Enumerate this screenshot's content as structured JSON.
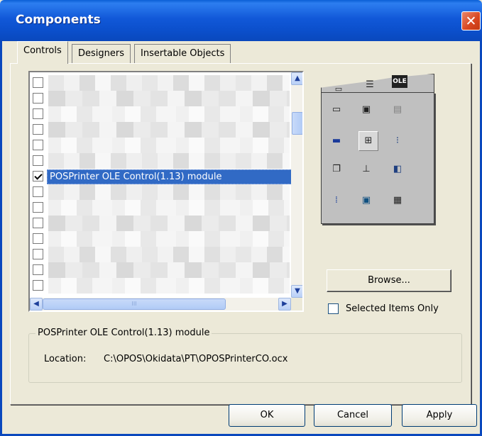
{
  "window": {
    "title": "Components"
  },
  "tabs": [
    {
      "label": "Controls"
    },
    {
      "label": "Designers"
    },
    {
      "label": "Insertable Objects"
    }
  ],
  "list": {
    "selected_item": "POSPrinter OLE Control(1.13) module",
    "scroll_hint": "III"
  },
  "toolbox": {
    "ole_label": "OLE"
  },
  "browse_button": "Browse...",
  "selected_only": {
    "label": "Selected Items Only",
    "checked": false
  },
  "details": {
    "group_title": "POSPrinter OLE Control(1.13) module",
    "location_label": "Location:",
    "location_value": "C:\\OPOS\\Okidata\\PT\\OPOSPrinterCO.ocx"
  },
  "buttons": {
    "ok": "OK",
    "cancel": "Cancel",
    "apply": "Apply"
  },
  "colors": {
    "titlebar": "#0a48bd",
    "selection": "#316ac5",
    "face": "#ece9d8"
  }
}
